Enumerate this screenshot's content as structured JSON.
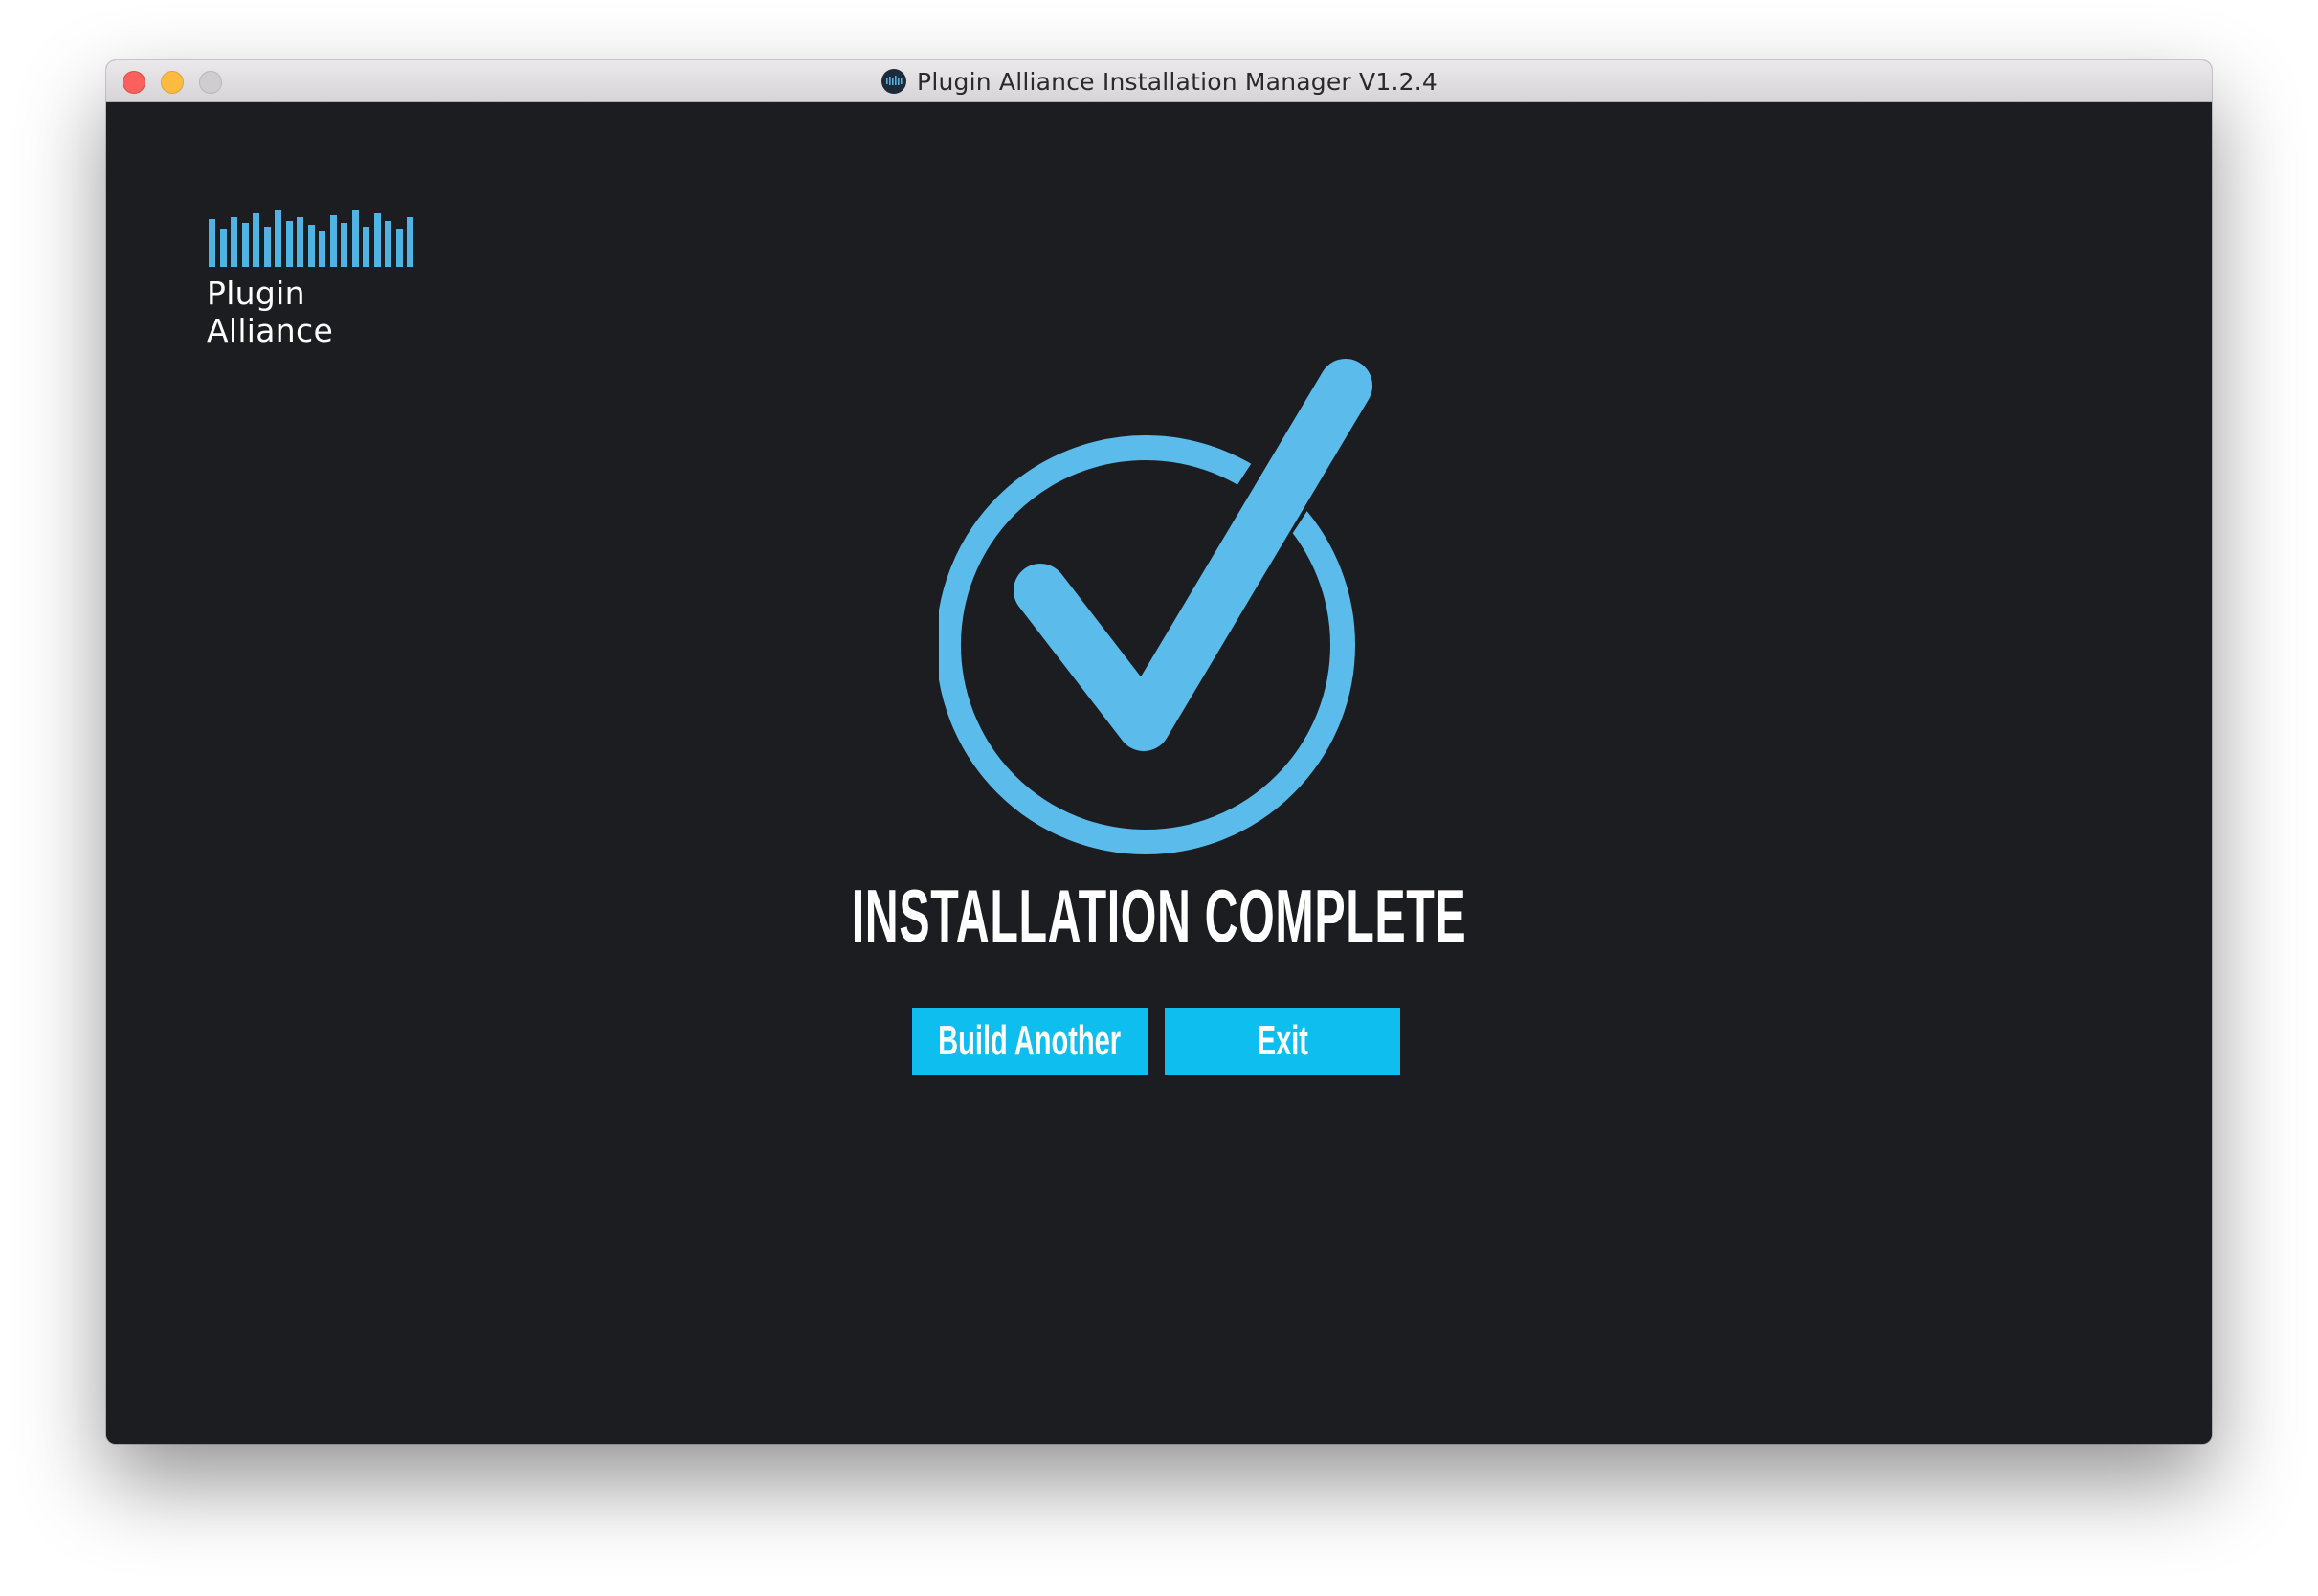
{
  "window": {
    "title": "Plugin Alliance Installation Manager V1.2.4",
    "app_icon": "plugin-alliance-icon"
  },
  "titlebar": {
    "buttons": [
      "close",
      "minimize",
      "zoom"
    ]
  },
  "logo": {
    "text": "Plugin Alliance",
    "icon": "waveform-bars-icon",
    "color": "#4fb3e4"
  },
  "main": {
    "status_icon": "check-circle-icon",
    "status_icon_color": "#5bbcec",
    "heading": "INSTALLATION COMPLETE",
    "buttons": {
      "build_another": "Build Another",
      "exit": "Exit"
    },
    "button_color": "#0dbeef",
    "background_color": "#1c1d21"
  }
}
